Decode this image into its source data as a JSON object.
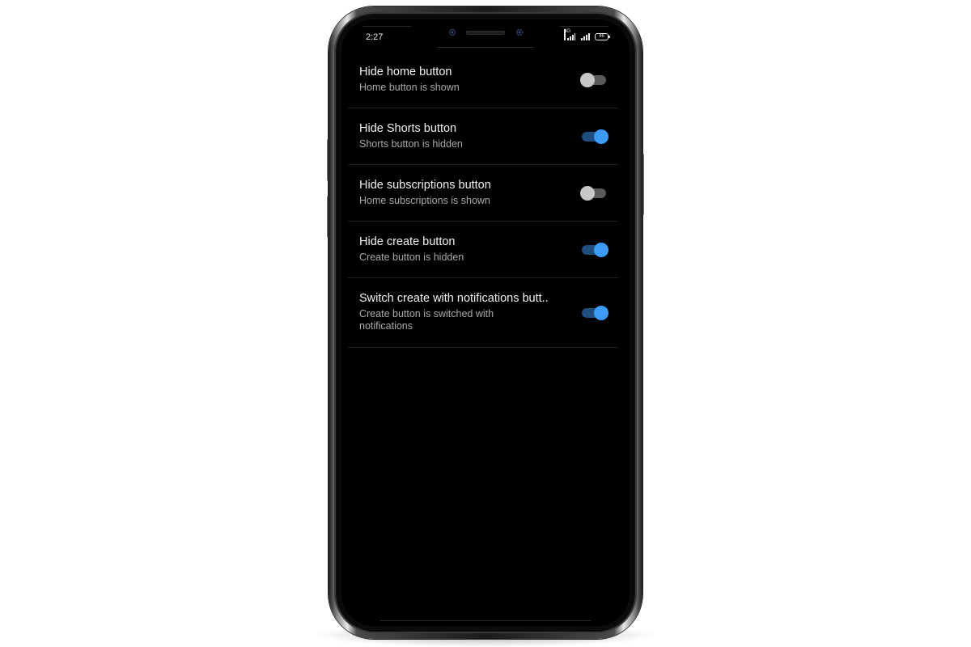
{
  "status_bar": {
    "time": "2:27",
    "network_label": "4G",
    "battery_level": "46"
  },
  "settings": [
    {
      "title": "Hide home button",
      "subtitle": "Home button is shown",
      "enabled": false
    },
    {
      "title": "Hide Shorts button",
      "subtitle": "Shorts button is hidden",
      "enabled": true
    },
    {
      "title": "Hide subscriptions button",
      "subtitle": "Home subscriptions is shown",
      "enabled": false
    },
    {
      "title": "Hide create button",
      "subtitle": "Create button is hidden",
      "enabled": true
    },
    {
      "title": "Switch create with notifications butt..",
      "subtitle": "Create button is switched with notifications",
      "enabled": true
    }
  ],
  "colors": {
    "screen_background": "#000000",
    "toggle_on_thumb": "#3b9bf5",
    "toggle_on_track": "#1e4e7e",
    "toggle_off_thumb": "#c8c8c8",
    "toggle_off_track": "#5a5a5a",
    "title_text": "#f2f2f2",
    "subtitle_text": "#a9a9a9"
  },
  "icons": {
    "signal_1": "cellular-signal-icon",
    "signal_2": "cellular-signal-icon",
    "battery": "battery-icon"
  }
}
